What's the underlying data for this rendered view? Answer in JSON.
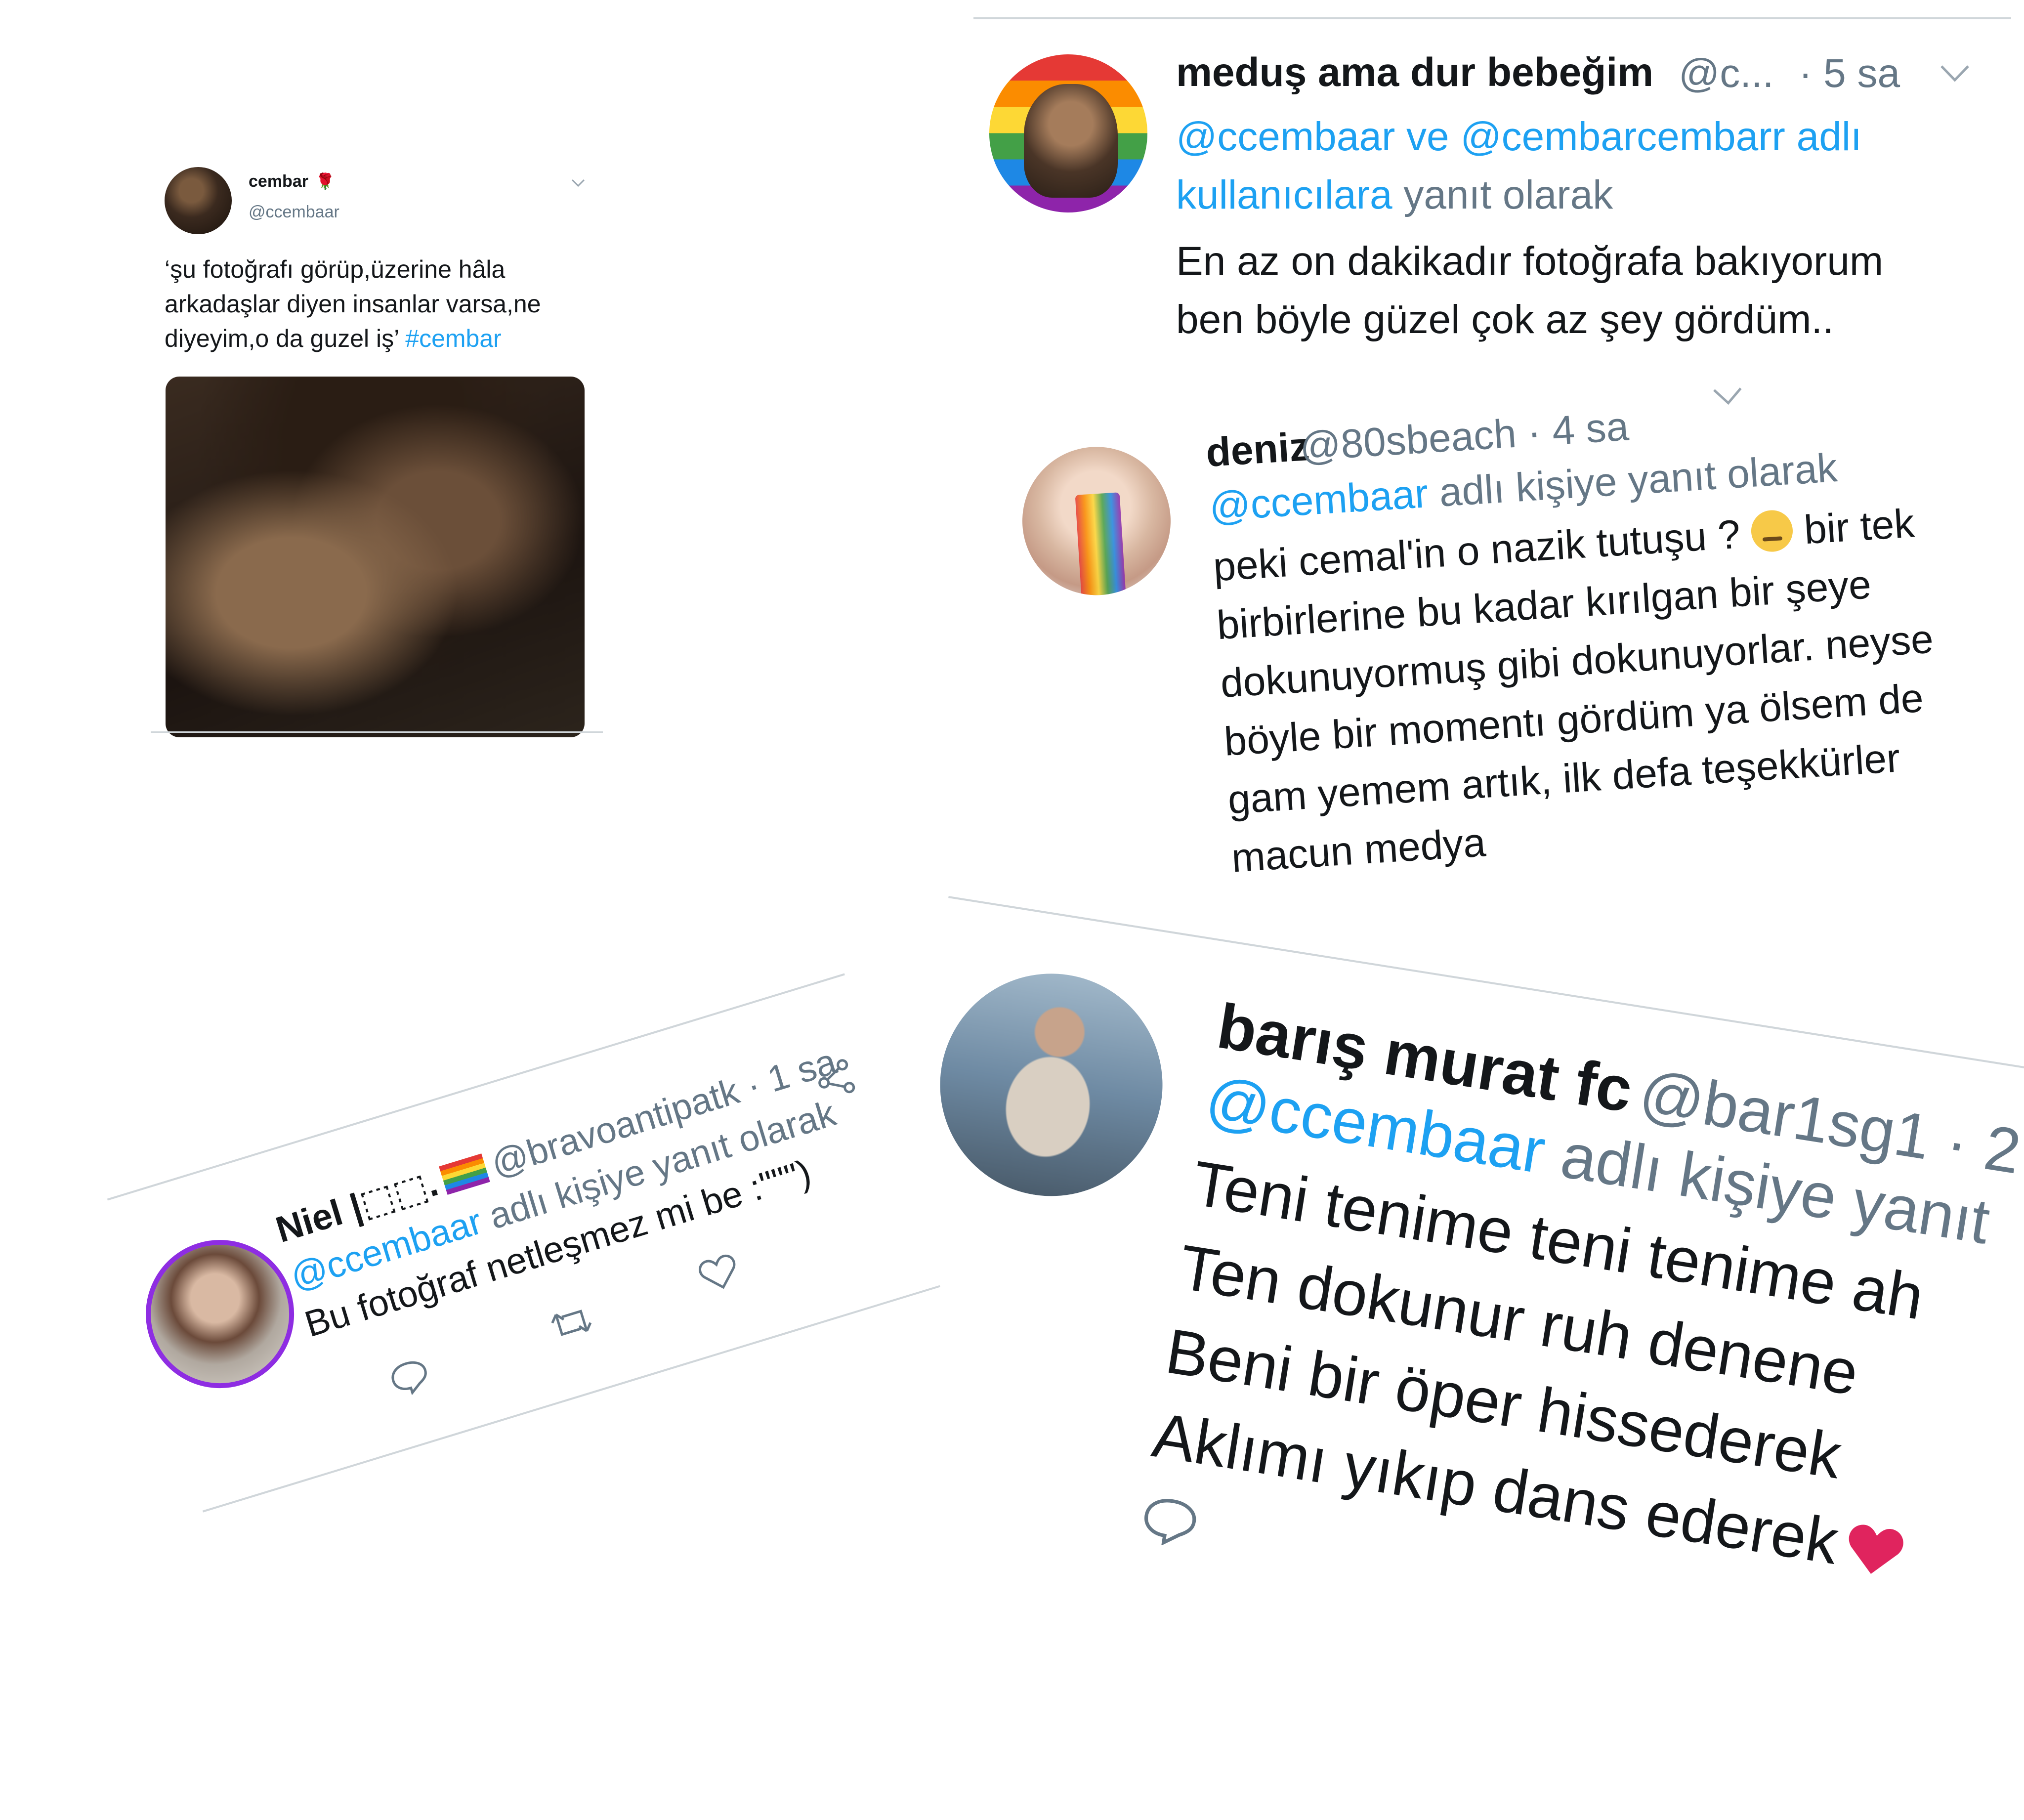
{
  "colors": {
    "link": "#1da1f2",
    "muted": "#657786",
    "text": "#14171a",
    "heart": "#e0245e",
    "avatar_ring": "#8e2de2"
  },
  "tweet_main": {
    "username": "cembar",
    "username_icon": "rose-icon",
    "handle": "@ccembaar",
    "text_lines": [
      "‘şu fotoğrafı görüp,üzerine hâla",
      "arkadaşlar diyen insanlar varsa,ne",
      "diyeyim,o da guzel iş’ "
    ],
    "hashtag": "#cembar"
  },
  "reply_medus": {
    "username": "meduş ama dur bebeğim",
    "handle": "@c...",
    "time": "· 5 sa",
    "reply_prefix": "@ccembaar ve @cembarcembarr adlı",
    "reply_line2": "kullanıcılara",
    "reply_suffix": " yanıt olarak",
    "body_lines": [
      "En az on dakikadır fotoğrafa bakıyorum",
      "ben böyle güzel çok az şey gördüm.."
    ]
  },
  "reply_deniz": {
    "username": "deniz",
    "handle": "@80sbeach · 4 sa",
    "mention": "@ccembaar",
    "reply_suffix": " adlı kişiye yanıt olarak",
    "body_line1_a": "peki cemal'in o nazik tutuşu ? ",
    "body_line1_b": " bir tek",
    "body_lines": [
      "birbirlerine bu kadar kırılgan bir şeye",
      "dokunuyormuş gibi dokunuyorlar. neyse",
      "böyle bir momentı gördüm ya ölsem de",
      "gam yemem artık, ilk defa teşekkürler",
      "macun medya"
    ]
  },
  "reply_niel": {
    "username": "Niel |⬚⬚.",
    "handle": "@bravoantipatk · 1 sa",
    "mention": "@ccembaar",
    "reply_suffix": " adlı kişiye yanıt olarak",
    "body": "Bu fotoğraf netleşmez mi be :\"\"\")"
  },
  "reply_baris": {
    "username": "barış murat fc",
    "handle": "@bar1sg1 · 2",
    "mention": "@ccembaar",
    "reply_suffix": " adlı kişiye yanıt",
    "body_lines": [
      "Teni tenime teni tenime ah",
      "Ten dokunur ruh denene",
      "Beni bir öper hissederek",
      "Aklımı yıkıp dans ederek"
    ]
  }
}
